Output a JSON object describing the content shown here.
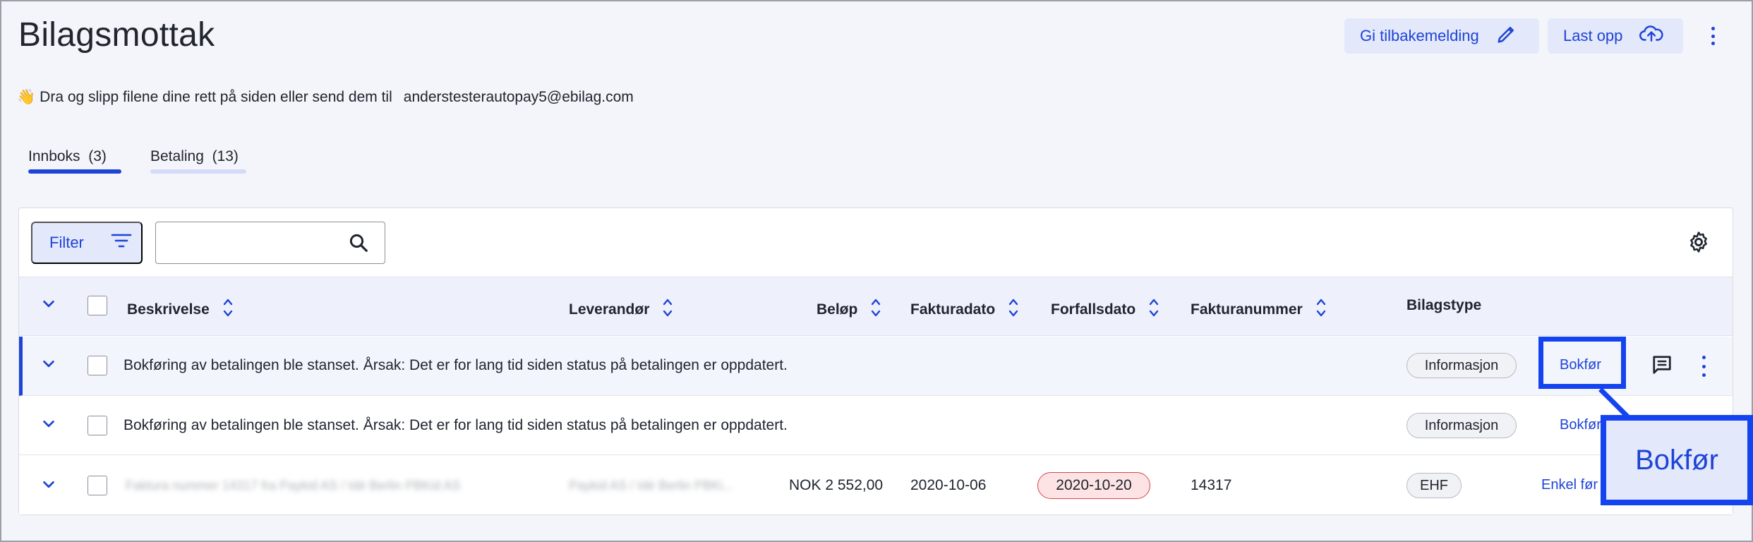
{
  "page": {
    "title": "Bilagsmottak",
    "buttons": {
      "feedback": "Gi tilbakemelding",
      "upload": "Last opp"
    },
    "hint": {
      "emoji": "👋",
      "text": "Dra og slipp filene dine rett på siden eller send dem til",
      "email": "anderstesterautopay5@ebilag.com"
    }
  },
  "tabs": [
    {
      "label": "Innboks",
      "count": "(3)"
    },
    {
      "label": "Betaling",
      "count": "(13)"
    }
  ],
  "toolbar": {
    "filter_label": "Filter",
    "search_placeholder": ""
  },
  "table": {
    "columns": [
      "Beskrivelse",
      "Leverandør",
      "Beløp",
      "Fakturadato",
      "Forfallsdato",
      "Fakturanummer",
      "Bilagstype"
    ],
    "rows": [
      {
        "description": "Bokføring av betalingen ble stanset. Årsak: Det er for lang tid siden status på betalingen er oppdatert.",
        "supplier": "",
        "amount": "",
        "invoice_date": "",
        "due_date": "",
        "invoice_number": "",
        "type": "Informasjon",
        "action": "Bokfør"
      },
      {
        "description": "Bokføring av betalingen ble stanset. Årsak: Det er for lang tid siden status på betalingen er oppdatert.",
        "supplier": "",
        "amount": "",
        "invoice_date": "",
        "due_date": "",
        "invoice_number": "",
        "type": "Informasjon",
        "action": "Bokfør"
      },
      {
        "description": "Faktura nummer 14317 fra Paykid AS / Idé Berlin PBKid AS",
        "supplier": "Paykid AS / Idé Berlin PBKi...",
        "amount": "NOK 2 552,00",
        "invoice_date": "2020-10-06",
        "due_date": "2020-10-20",
        "invoice_number": "14317",
        "type": "EHF",
        "action": "Enkel før"
      }
    ]
  },
  "callout": {
    "label": "Bokfør"
  },
  "colors": {
    "accent": "#1e44d6",
    "highlight": "#1344f0",
    "background": "#f4f5fa",
    "overdue_bg": "#fde3e3",
    "overdue_border": "#d9464a"
  }
}
